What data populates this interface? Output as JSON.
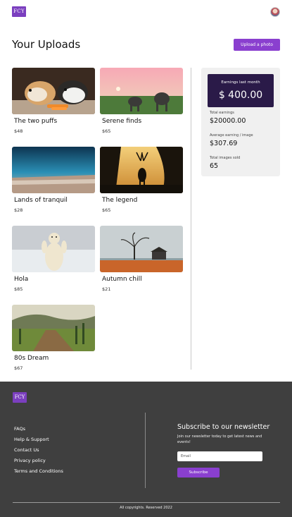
{
  "header": {
    "logo_text": "FCY",
    "avatar": "user-avatar"
  },
  "main": {
    "title": "Your Uploads",
    "upload_button": "Upload a photo",
    "uploads": [
      {
        "title": "The two puffs",
        "price": "$48"
      },
      {
        "title": "Serene finds",
        "price": "$65"
      },
      {
        "title": "Lands of tranquil",
        "price": "$28"
      },
      {
        "title": "The legend",
        "price": "$65"
      },
      {
        "title": "Hola",
        "price": "$85"
      },
      {
        "title": "Autumn chill",
        "price": "$21"
      },
      {
        "title": "80s Dream",
        "price": "$67"
      }
    ]
  },
  "stats": {
    "earnings_last_month_label": "Earnings last month",
    "earnings_last_month_value": "$ 400.00",
    "total_earnings_label": "Total earnings",
    "total_earnings_value": "$20000.00",
    "average_label": "Average earning / image",
    "average_value": "$307.69",
    "sold_label": "Total images sold",
    "sold_value": "65"
  },
  "footer": {
    "logo_text": "FCY",
    "links": [
      "FAQs",
      "Help & Support",
      "Contact Us",
      "Privacy policy",
      "Terms and Conditions"
    ],
    "newsletter_title": "Subscribe to our newsletter",
    "newsletter_desc": "Join our newsletter today to get latest news and events!",
    "email_placeholder": "Email",
    "subscribe_label": "Subscribe",
    "copyright": "All copyrights. Reserved 2022"
  },
  "colors": {
    "accent": "#8a3fcf",
    "earnings_box": "#2a1a48",
    "footer_bg": "#3f3f3f"
  }
}
